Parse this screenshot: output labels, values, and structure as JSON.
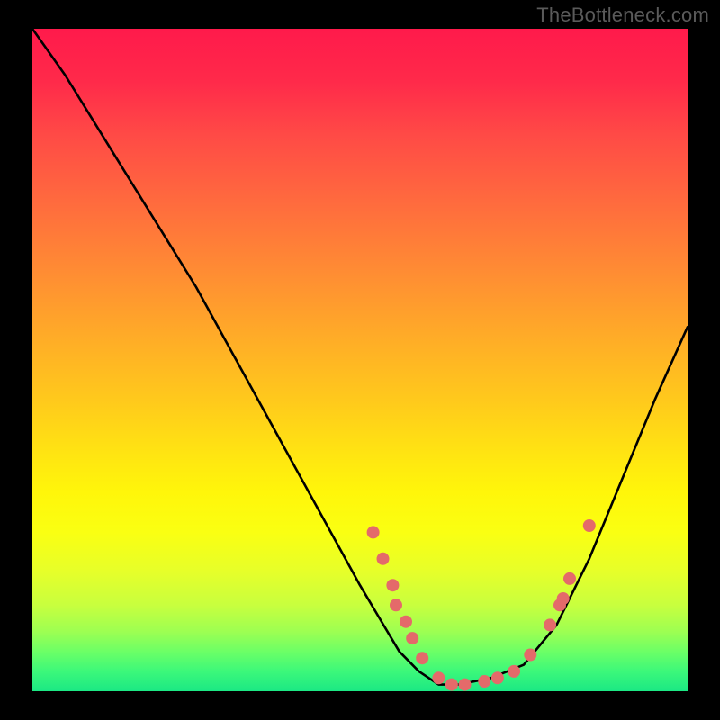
{
  "watermark": "TheBottleneck.com",
  "chart_data": {
    "type": "line",
    "title": "",
    "xlabel": "",
    "ylabel": "",
    "xlim": [
      0,
      100
    ],
    "ylim": [
      0,
      100
    ],
    "series": [
      {
        "name": "curve",
        "x": [
          0,
          5,
          10,
          15,
          20,
          25,
          30,
          35,
          40,
          45,
          50,
          53,
          56,
          59,
          62,
          65,
          70,
          75,
          80,
          85,
          90,
          95,
          100
        ],
        "y": [
          100,
          93,
          85,
          77,
          69,
          61,
          52,
          43,
          34,
          25,
          16,
          11,
          6,
          3,
          1,
          1,
          2,
          4,
          10,
          20,
          32,
          44,
          55
        ]
      }
    ],
    "markers": [
      {
        "x": 52,
        "y": 24
      },
      {
        "x": 53.5,
        "y": 20
      },
      {
        "x": 55,
        "y": 16
      },
      {
        "x": 55.5,
        "y": 13
      },
      {
        "x": 57,
        "y": 10.5
      },
      {
        "x": 58,
        "y": 8
      },
      {
        "x": 59.5,
        "y": 5
      },
      {
        "x": 62,
        "y": 2
      },
      {
        "x": 64,
        "y": 1
      },
      {
        "x": 66,
        "y": 1
      },
      {
        "x": 69,
        "y": 1.5
      },
      {
        "x": 71,
        "y": 2
      },
      {
        "x": 73.5,
        "y": 3
      },
      {
        "x": 76,
        "y": 5.5
      },
      {
        "x": 79,
        "y": 10
      },
      {
        "x": 80.5,
        "y": 13
      },
      {
        "x": 81,
        "y": 14
      },
      {
        "x": 82,
        "y": 17
      },
      {
        "x": 85,
        "y": 25
      }
    ],
    "gradient_stops": [
      {
        "pos": 0.0,
        "color": "#ff1a4b"
      },
      {
        "pos": 0.5,
        "color": "#ffcc1a"
      },
      {
        "pos": 0.75,
        "color": "#fff60a"
      },
      {
        "pos": 1.0,
        "color": "#1be884"
      }
    ]
  }
}
